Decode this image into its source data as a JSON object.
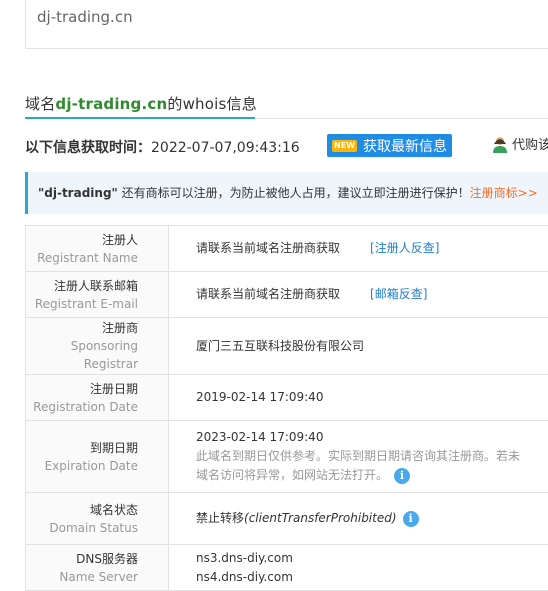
{
  "search": {
    "value": "dj-trading.cn"
  },
  "section": {
    "prefix": "域名",
    "domain": "dj-trading.cn",
    "suffix": "的whois信息"
  },
  "time_row": {
    "label": "以下信息获取时间：",
    "value": "2022-07-07,09:43:16"
  },
  "refresh_button": {
    "badge": "NEW",
    "label": "获取最新信息"
  },
  "agent": {
    "label": "代购该"
  },
  "notice": {
    "quote_open": "\"",
    "name": "dj-trading",
    "quote_close": "\"",
    "text": " 还有商标可以注册，为防止被他人占用，建议立即注册进行保护！",
    "link": "注册商标>>"
  },
  "rows": [
    {
      "cn": "注册人",
      "en": "Registrant Name",
      "value": "请联系当前域名注册商获取",
      "link": "[注册人反查]"
    },
    {
      "cn": "注册人联系邮箱",
      "en": "Registrant E-mail",
      "value": "请联系当前域名注册商获取",
      "link": "[邮箱反查]"
    },
    {
      "cn": "注册商",
      "en": "Sponsoring Registrar",
      "value": "厦门三五互联科技股份有限公司"
    },
    {
      "cn": "注册日期",
      "en": "Registration Date",
      "value": "2019-02-14 17:09:40"
    },
    {
      "cn": "到期日期",
      "en": "Expiration Date",
      "value": "2023-02-14 17:09:40",
      "note1": "此域名到期日仅供参考。实际到期日期请咨询其注册商。若未",
      "note2": "域名访问将异常，如网站无法打开。"
    },
    {
      "cn": "域名状态",
      "en": "Domain Status",
      "value": "禁止转移",
      "value_en": "(clientTransferProhibited)"
    },
    {
      "cn": "DNS服务器",
      "en": "Name Server",
      "value1": "ns3.dns-diy.com",
      "value2": "ns4.dns-diy.com"
    }
  ],
  "colors": {
    "accent": "#1f8ce6",
    "domain_green": "#2e8b2e",
    "notice_link": "#ff6a2a",
    "info_icon": "#4aa9ea"
  },
  "icons": {
    "info": "i",
    "agent": "person-avatar-icon"
  }
}
